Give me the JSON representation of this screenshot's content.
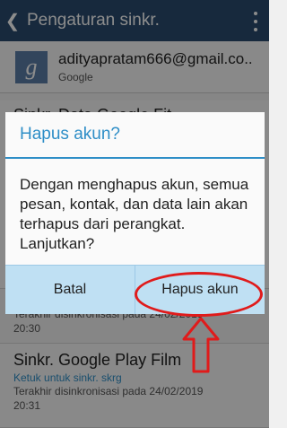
{
  "actionbar": {
    "title": "Pengaturan sinkr.",
    "back_icon": "chevron-left-icon",
    "menu_icon": "overflow-menu-icon"
  },
  "account": {
    "email": "adityapratam666@gmail.co..",
    "type": "Google",
    "logo_glyph": "g"
  },
  "sync_items": [
    {
      "title": "Sinkr. Data Google Fit",
      "subtitle": "",
      "last_sync": "Terakhir disinkronisasi pada 24/02/2019",
      "last_sync_time": "20:30"
    },
    {
      "title": "Sinkr. Google Play Film",
      "subtitle": "Ketuk untuk sinkr. skrg",
      "last_sync": "Terakhir disinkronisasi pada 24/02/2019",
      "last_sync_time": "20:31"
    }
  ],
  "dialog": {
    "title": "Hapus akun?",
    "message": "Dengan menghapus akun, semua pesan, kontak, dan data lain akan terhapus dari perangkat. Lanjutkan?",
    "cancel_label": "Batal",
    "confirm_label": "Hapus akun"
  },
  "colors": {
    "actionbar": "#2a4c6f",
    "accent": "#2e8ec7",
    "button_bar": "#bfe0f3",
    "annotation": "#e01b1b"
  }
}
